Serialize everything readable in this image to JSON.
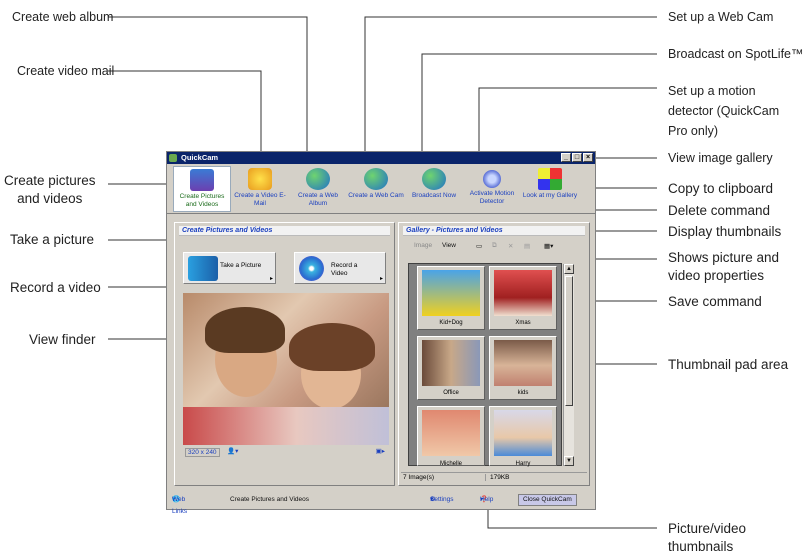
{
  "callouts": {
    "create_web_album": "Create web album",
    "create_video_mail": "Create video mail",
    "create_pictures_videos": "Create pictures\nand videos",
    "take_picture": "Take a picture",
    "record_video": "Record a video",
    "view_finder": "View finder",
    "set_up_web_cam": "Set up a Web Cam",
    "broadcast_spotlife": "Broadcast on SpotLife™",
    "motion_detector": "Set up a motion\ndetector (QuickCam\nPro only)",
    "view_gallery": "View image gallery",
    "copy_clipboard": "Copy to clipboard",
    "delete_command": "Delete command",
    "display_thumbnails": "Display thumbnails",
    "properties": "Shows picture and\nvideo properties",
    "save_command": "Save command",
    "thumbnail_pad": "Thumbnail pad area",
    "picture_video_thumbnails": "Picture/video\nthumbnails"
  },
  "window": {
    "title": "QuickCam",
    "toolbar": [
      {
        "label": "Create Pictures and Videos",
        "icon": "camera-pictures-icon",
        "active": true
      },
      {
        "label": "Create a Video E-Mail",
        "icon": "video-mail-icon"
      },
      {
        "label": "Create a Web Album",
        "icon": "web-album-icon"
      },
      {
        "label": "Create a Web Cam",
        "icon": "web-cam-icon"
      },
      {
        "label": "Broadcast Now",
        "icon": "broadcast-icon"
      },
      {
        "label": "Activate Motion Detector",
        "icon": "motion-detector-icon"
      },
      {
        "label": "Look at my Gallery",
        "icon": "gallery-icon"
      }
    ],
    "left_panel": {
      "title": "Create Pictures and Videos",
      "take_picture": "Take a Picture",
      "record_video": "Record a Video",
      "resolution": "320 x 240"
    },
    "right_panel": {
      "title": "Gallery - Pictures and Videos",
      "image_label": "Image",
      "view_label": "View",
      "thumbnails": [
        {
          "caption": "Kid+Dog"
        },
        {
          "caption": "Xmas"
        },
        {
          "caption": "Office"
        },
        {
          "caption": "kids"
        },
        {
          "caption": "Michelle"
        },
        {
          "caption": "Harry"
        }
      ],
      "image_count": "7 Image(s)",
      "size": "179KB"
    },
    "bottom": {
      "web_links": "Web Links",
      "status": "Create Pictures and Videos",
      "settings": "Settings",
      "help": "Help",
      "close": "Close QuickCam"
    }
  }
}
